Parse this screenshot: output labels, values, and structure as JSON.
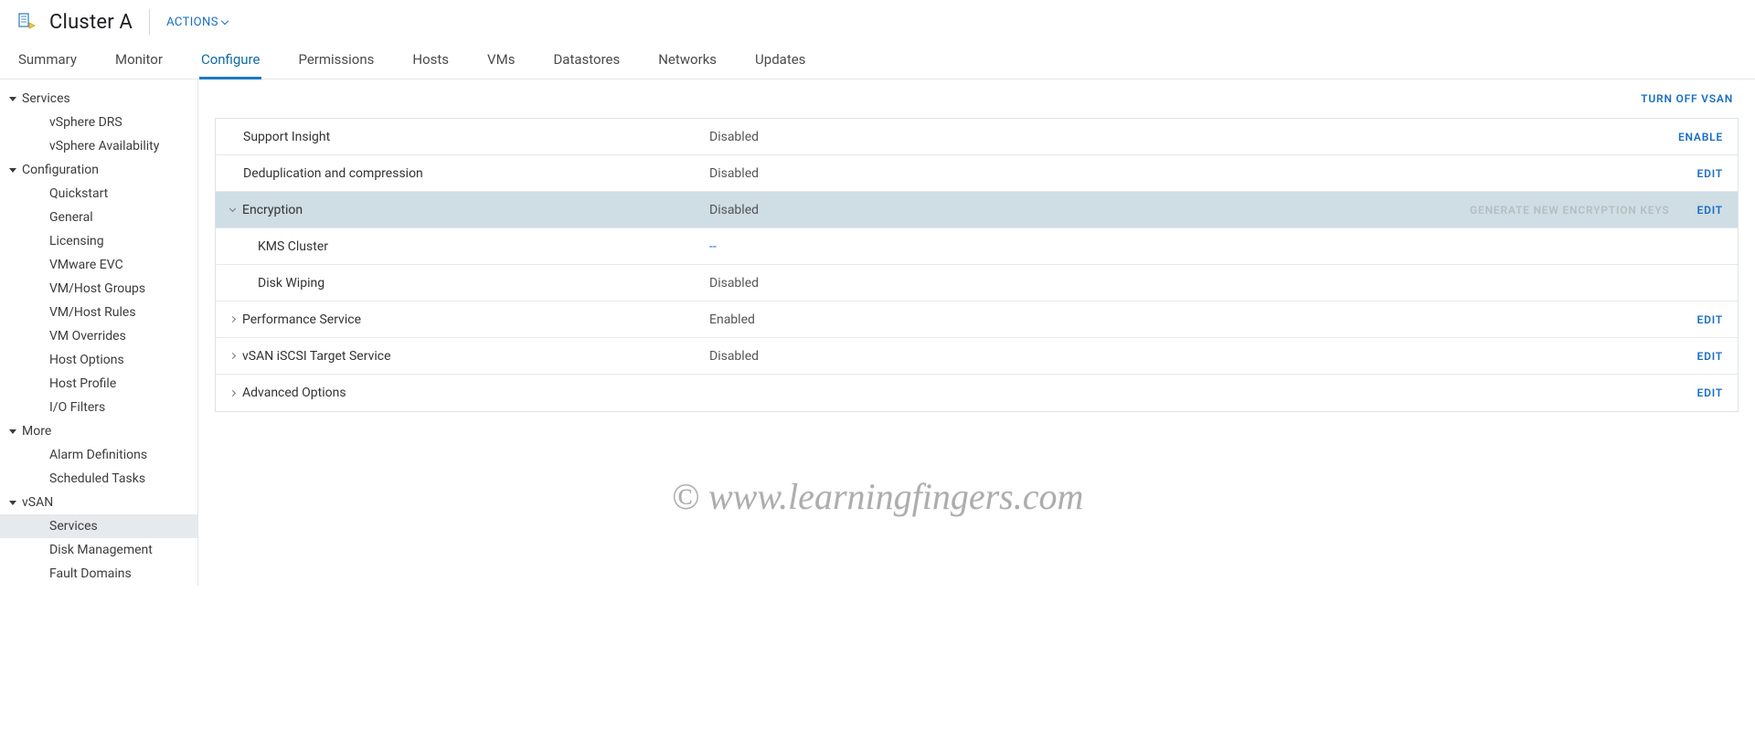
{
  "header": {
    "title": "Cluster A",
    "actions_label": "ACTIONS"
  },
  "tabs": [
    {
      "label": "Summary",
      "active": false
    },
    {
      "label": "Monitor",
      "active": false
    },
    {
      "label": "Configure",
      "active": true
    },
    {
      "label": "Permissions",
      "active": false
    },
    {
      "label": "Hosts",
      "active": false
    },
    {
      "label": "VMs",
      "active": false
    },
    {
      "label": "Datastores",
      "active": false
    },
    {
      "label": "Networks",
      "active": false
    },
    {
      "label": "Updates",
      "active": false
    }
  ],
  "sidebar": {
    "groups": [
      {
        "label": "Services",
        "items": [
          {
            "label": "vSphere DRS",
            "selected": false
          },
          {
            "label": "vSphere Availability",
            "selected": false
          }
        ]
      },
      {
        "label": "Configuration",
        "items": [
          {
            "label": "Quickstart",
            "selected": false
          },
          {
            "label": "General",
            "selected": false
          },
          {
            "label": "Licensing",
            "selected": false
          },
          {
            "label": "VMware EVC",
            "selected": false
          },
          {
            "label": "VM/Host Groups",
            "selected": false
          },
          {
            "label": "VM/Host Rules",
            "selected": false
          },
          {
            "label": "VM Overrides",
            "selected": false
          },
          {
            "label": "Host Options",
            "selected": false
          },
          {
            "label": "Host Profile",
            "selected": false
          },
          {
            "label": "I/O Filters",
            "selected": false
          }
        ]
      },
      {
        "label": "More",
        "items": [
          {
            "label": "Alarm Definitions",
            "selected": false
          },
          {
            "label": "Scheduled Tasks",
            "selected": false
          }
        ]
      },
      {
        "label": "vSAN",
        "items": [
          {
            "label": "Services",
            "selected": true
          },
          {
            "label": "Disk Management",
            "selected": false
          },
          {
            "label": "Fault Domains",
            "selected": false
          }
        ]
      }
    ]
  },
  "main": {
    "turn_off_label": "TURN OFF VSAN",
    "rows": [
      {
        "name": "support-insight",
        "label": "Support Insight",
        "value": "Disabled",
        "actions": [
          {
            "label": "ENABLE",
            "disabled": false
          }
        ]
      },
      {
        "name": "dedup-compression",
        "label": "Deduplication and compression",
        "value": "Disabled",
        "actions": [
          {
            "label": "EDIT",
            "disabled": false
          }
        ]
      },
      {
        "name": "encryption",
        "label": "Encryption",
        "value": "Disabled",
        "expandable": true,
        "expanded": true,
        "selected": true,
        "actions": [
          {
            "label": "GENERATE NEW ENCRYPTION KEYS",
            "disabled": true
          },
          {
            "label": "EDIT",
            "disabled": false
          }
        ],
        "children": [
          {
            "name": "kms-cluster",
            "label": "KMS Cluster",
            "value": "--",
            "value_link": true
          },
          {
            "name": "disk-wiping",
            "label": "Disk Wiping",
            "value": "Disabled"
          }
        ]
      },
      {
        "name": "performance-service",
        "label": "Performance Service",
        "value": "Enabled",
        "expandable": true,
        "expanded": false,
        "actions": [
          {
            "label": "EDIT",
            "disabled": false
          }
        ]
      },
      {
        "name": "vsan-iscsi-target",
        "label": "vSAN iSCSI Target Service",
        "value": "Disabled",
        "expandable": true,
        "expanded": false,
        "actions": [
          {
            "label": "EDIT",
            "disabled": false
          }
        ]
      },
      {
        "name": "advanced-options",
        "label": "Advanced Options",
        "value": "",
        "expandable": true,
        "expanded": false,
        "actions": [
          {
            "label": "EDIT",
            "disabled": false
          }
        ]
      }
    ]
  },
  "watermark": "© www.learningfingers.com"
}
